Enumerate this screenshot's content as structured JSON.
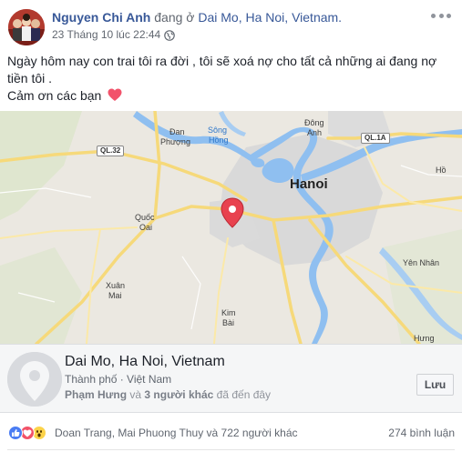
{
  "post": {
    "author_name": "Nguyen Chi Anh",
    "checkin_connector": "đang ở",
    "checkin_place": "Dai Mo, Ha Noi, Vietnam.",
    "timestamp": "23 Tháng 10 lúc 22:44",
    "audience_icon": "globe-icon",
    "message_line1": "Ngày hôm nay con trai tôi ra đời , tôi sẽ xoá nợ cho tất cả những ai đang nợ tiền tôi .",
    "message_line2": "Cảm ơn các bạn"
  },
  "map": {
    "labels": {
      "hanoi": "Hanoi",
      "song_hong_1": "Sông",
      "song_hong_2": "Hồng",
      "dan_phuong_1": "Đan",
      "dan_phuong_2": "Phượng",
      "dong_anh_1": "Đông",
      "dong_anh_2": "Anh",
      "quoc_oai_1": "Quốc",
      "quoc_oai_2": "Oai",
      "xuan_mai_1": "Xuân",
      "xuan_mai_2": "Mai",
      "kim_bai_1": "Kim",
      "kim_bai_2": "Bài",
      "yen_nhan": "Yên Nhân",
      "hung": "Hưng",
      "ho": "Hồ",
      "ql32": "QL.32",
      "ql1a": "QL.1A"
    },
    "colors": {
      "water": "#8fbff0",
      "urban": "#d8d8d8",
      "pin": "#e8424f",
      "major_road": "#f6d97a"
    }
  },
  "place": {
    "title": "Dai Mo, Ha Noi, Vietnam",
    "subtitle": "Thành phố · Việt Nam",
    "visitor_name": "Phạm Hưng",
    "visitor_connector": "và",
    "visitor_others": "3 người khác",
    "visitor_suffix": "đã đến đây",
    "save_label": "Lưu"
  },
  "engagement": {
    "reactions": [
      "like",
      "love",
      "wow"
    ],
    "reactors_text": "Doan Trang, Mai Phuong Thuy và 722 người khác",
    "comments_text": "274 bình luận"
  }
}
